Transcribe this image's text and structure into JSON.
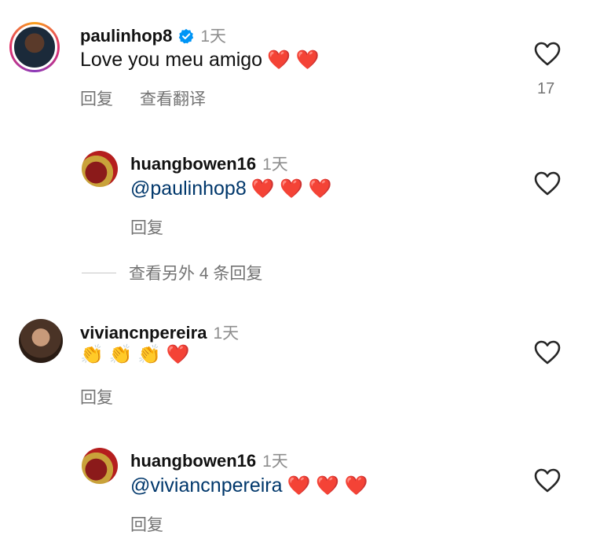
{
  "comments": [
    {
      "username": "paulinhop8",
      "time": "1天",
      "text": "Love you meu amigo",
      "emojis": "❤️ ❤️",
      "reply_label": "回复",
      "translate_label": "查看翻译",
      "like_count": "17"
    },
    {
      "username": "huangbowen16",
      "time": "1天",
      "mention": "@paulinhop8",
      "emojis": "❤️ ❤️ ❤️",
      "reply_label": "回复"
    },
    {
      "username": "viviancnpereira",
      "time": "1天",
      "emojis": "👏 👏 👏 ❤️",
      "reply_label": "回复"
    },
    {
      "username": "huangbowen16",
      "time": "1天",
      "mention": "@viviancnpereira",
      "emojis": "❤️ ❤️ ❤️",
      "reply_label": "回复"
    }
  ],
  "view_more_replies": "查看另外 4 条回复",
  "colors": {
    "mention": "#00376b",
    "secondary_text": "#737373",
    "verified_blue": "#0095f6"
  },
  "icons": [
    "heart-icon",
    "verified-badge-icon"
  ]
}
